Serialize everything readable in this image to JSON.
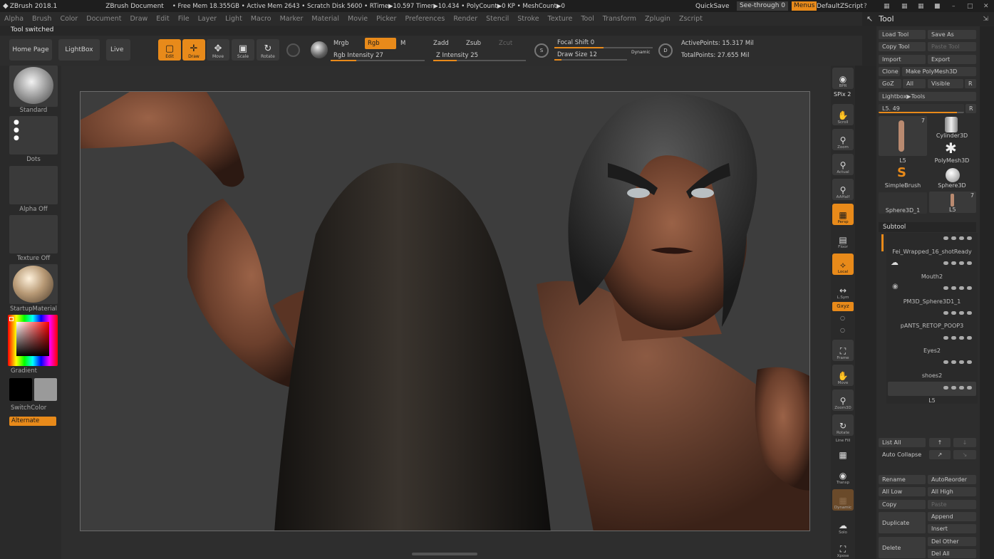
{
  "app": {
    "title": "ZBrush 2018.1",
    "document": "ZBrush Document",
    "stats": "• Free Mem 18.355GB • Active Mem 2643 • Scratch Disk 5600 • RTime▶10.597 Timer▶10.434 • PolyCount▶0 KP • MeshCount▶0",
    "quicksave": "QuickSave",
    "seethrough": "See-through  0",
    "menus": "Menus",
    "script": "DefaultZScript"
  },
  "menus": [
    "Alpha",
    "Brush",
    "Color",
    "Document",
    "Draw",
    "Edit",
    "File",
    "Layer",
    "Light",
    "Macro",
    "Marker",
    "Material",
    "Movie",
    "Picker",
    "Preferences",
    "Render",
    "Stencil",
    "Stroke",
    "Texture",
    "Tool",
    "Transform",
    "Zplugin",
    "Zscript"
  ],
  "status": "Tool switched",
  "toolbar": {
    "home": "Home Page",
    "lightbox": "LightBox",
    "live": "Live",
    "edit": "Edit",
    "draw": "Draw",
    "move": "Move",
    "scale": "Scale",
    "rotate": "Rotate",
    "mrgb": "Mrgb",
    "rgb": "Rgb",
    "m": "M",
    "rgb_intensity": "Rgb Intensity 27",
    "zadd": "Zadd",
    "zsub": "Zsub",
    "zcut": "Zcut",
    "z_intensity": "Z Intensity 25",
    "focal": "Focal Shift 0",
    "drawsize": "Draw Size 12",
    "dynamic": "Dynamic",
    "active_points": "ActivePoints: 15.317 Mil",
    "total_points": "TotalPoints: 27.655 Mil",
    "rgb_fill": 0.27,
    "z_fill": 0.25,
    "focal_fill": 0.5,
    "size_fill": 0.1
  },
  "leftshelf": {
    "brush": "Standard",
    "stroke": "Dots",
    "alpha": "Alpha Off",
    "texture": "Texture Off",
    "material": "StartupMaterial",
    "gradient": "Gradient",
    "switch": "SwitchColor",
    "alternate": "Alternate"
  },
  "rightshelf": [
    "BPR",
    "SPix 2",
    "Scroll",
    "Zoom",
    "Actual",
    "AAHalf",
    "Persp",
    "Floor",
    "Local",
    "L.Sym",
    "Gxyz",
    "Frame",
    "Move",
    "Zoom3D",
    "Rotate",
    "Line Fill",
    "Transp",
    "Dynamic",
    "Solo",
    "Xpose"
  ],
  "tray": {
    "title": "Tool"
  },
  "tool": {
    "load": "Load Tool",
    "saveas": "Save As",
    "copy": "Copy Tool",
    "paste": "Paste Tool",
    "import": "Import",
    "export": "Export",
    "clone": "Clone",
    "makepoly": "Make PolyMesh3D",
    "goz": "GoZ",
    "all": "All",
    "visible": "Visible",
    "r": "R",
    "lightbox_tools": "Lightbox▶Tools",
    "ls": "L5. 49",
    "r2": "R",
    "thumbs": [
      "L5",
      "Cylinder3D",
      "SimpleBrush",
      "PolyMesh3D",
      "Sphere3D",
      "Sphere3D_1",
      "L5"
    ],
    "thumb_count": "7",
    "thumb_count2": "7"
  },
  "subtool": {
    "header": "Subtool",
    "items": [
      "Fei_Wrapped_16_shotReady",
      "Mouth2",
      "PM3D_Sphere3D1_1",
      "pANTS_RETOP_POOP3",
      "Eyes2",
      "shoes2",
      "L5"
    ],
    "buttons": {
      "listall": "List All",
      "autocollapse": "Auto Collapse",
      "rename": "Rename",
      "autoreorder": "AutoReorder",
      "alllow": "All Low",
      "allhigh": "All High",
      "copy": "Copy",
      "paste": "Paste",
      "duplicate": "Duplicate",
      "append": "Append",
      "insert": "Insert",
      "delete": "Delete",
      "delother": "Del Other",
      "delall": "Del All"
    }
  },
  "colors": {
    "accent": "#e88a1a",
    "bg": "#272727"
  }
}
